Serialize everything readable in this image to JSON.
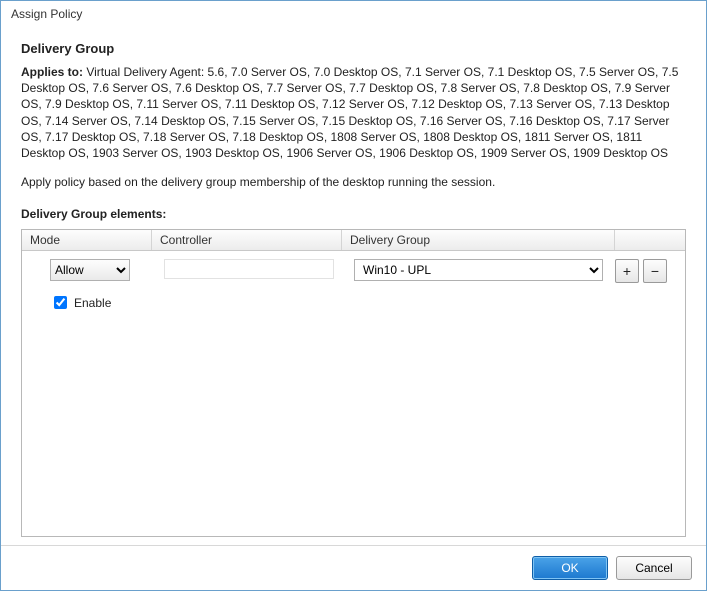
{
  "window": {
    "title": "Assign Policy"
  },
  "header": {
    "heading": "Delivery Group",
    "applies_label": "Applies to:",
    "applies_text": "Virtual Delivery Agent: 5.6, 7.0 Server OS, 7.0 Desktop OS, 7.1 Server OS, 7.1 Desktop OS, 7.5 Server OS, 7.5 Desktop OS, 7.6 Server OS, 7.6 Desktop OS, 7.7 Server OS, 7.7 Desktop OS, 7.8 Server OS, 7.8 Desktop OS, 7.9 Server OS, 7.9 Desktop OS, 7.11 Server OS, 7.11 Desktop OS, 7.12 Server OS, 7.12 Desktop OS, 7.13 Server OS, 7.13 Desktop OS, 7.14 Server OS, 7.14 Desktop OS, 7.15 Server OS, 7.15 Desktop OS, 7.16 Server OS, 7.16 Desktop OS, 7.17 Server OS, 7.17 Desktop OS, 7.18 Server OS, 7.18 Desktop OS, 1808 Server OS, 1808 Desktop OS, 1811 Server OS, 1811 Desktop OS, 1903 Server OS, 1903 Desktop OS, 1906 Server OS, 1906 Desktop OS, 1909 Server OS, 1909 Desktop OS",
    "description": "Apply policy based on the delivery group membership of the desktop running the session."
  },
  "table": {
    "subheading": "Delivery Group elements:",
    "columns": {
      "mode": "Mode",
      "controller": "Controller",
      "delivery_group": "Delivery Group"
    },
    "rows": [
      {
        "mode_value": "Allow",
        "controller_value": "",
        "delivery_group_value": "Win10 - UPL"
      }
    ],
    "enable_label": "Enable",
    "enable_checked": true,
    "add_label": "+",
    "remove_label": "−"
  },
  "footer": {
    "ok": "OK",
    "cancel": "Cancel"
  }
}
